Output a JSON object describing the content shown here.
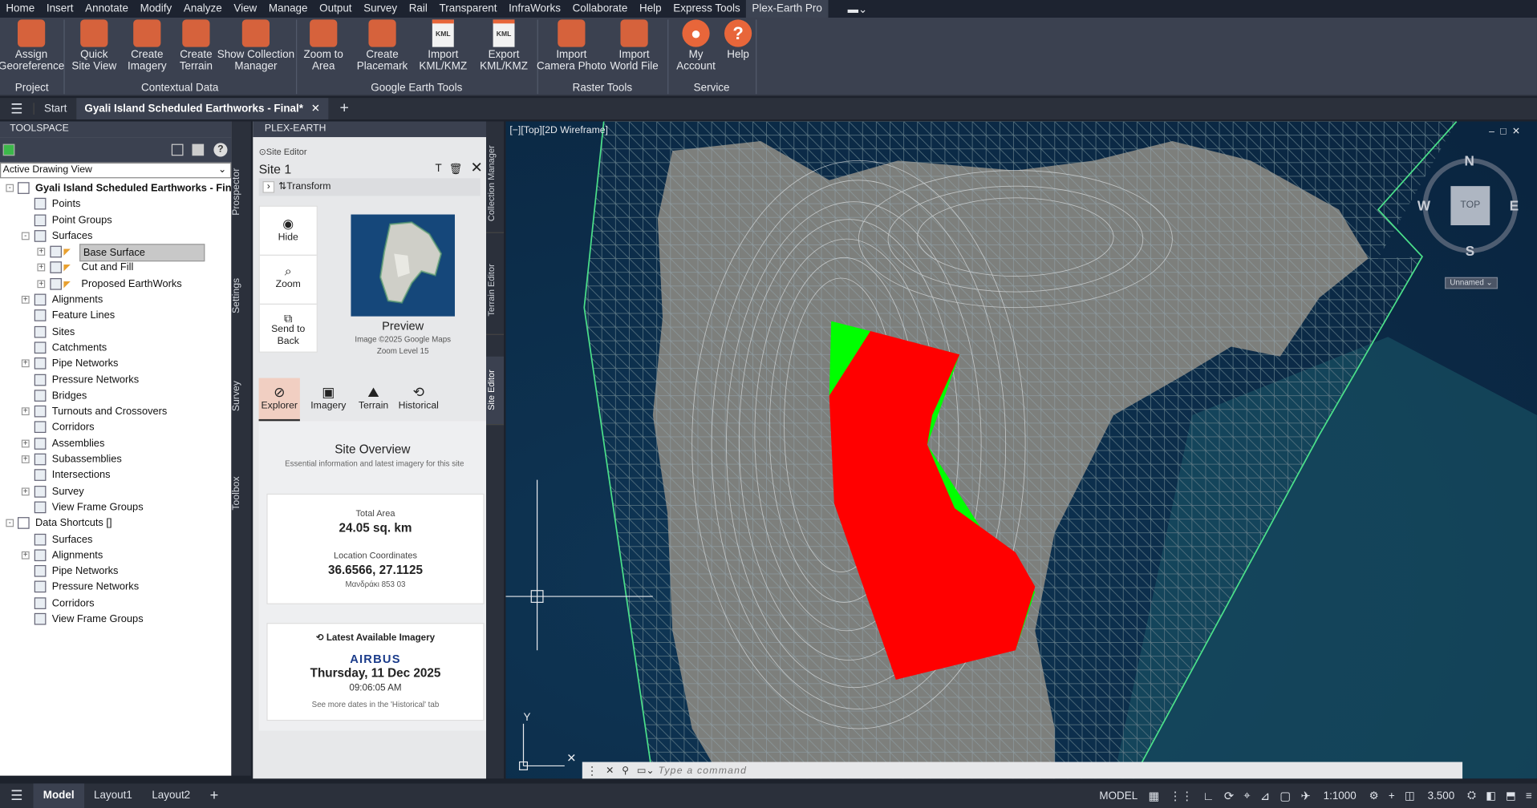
{
  "menu": [
    "Home",
    "Insert",
    "Annotate",
    "Modify",
    "Analyze",
    "View",
    "Manage",
    "Output",
    "Survey",
    "Rail",
    "Transparent",
    "InfraWorks",
    "Collaborate",
    "Help",
    "Express Tools",
    "Plex-Earth Pro"
  ],
  "ribbon": {
    "buttons": [
      {
        "l1": "Assign",
        "l2": "Georeference"
      },
      {
        "l1": "Quick",
        "l2": "Site View"
      },
      {
        "l1": "Create",
        "l2": "Imagery"
      },
      {
        "l1": "Create",
        "l2": "Terrain"
      },
      {
        "l1": "Show Collection",
        "l2": "Manager"
      },
      {
        "l1": "Zoom to",
        "l2": "Area"
      },
      {
        "l1": "Create",
        "l2": "Placemark"
      },
      {
        "l1": "Import",
        "l2": "KML/KMZ"
      },
      {
        "l1": "Export",
        "l2": "KML/KMZ"
      },
      {
        "l1": "Import",
        "l2": "Camera Photo"
      },
      {
        "l1": "Import",
        "l2": "World File"
      },
      {
        "l1": "My",
        "l2": "Account"
      },
      {
        "l1": "Help",
        "l2": ""
      }
    ],
    "panels": [
      "Project",
      "Contextual Data",
      "Google Earth Tools",
      "Raster Tools",
      "Service"
    ],
    "kml_badge": "KML"
  },
  "tabs": {
    "start": "Start",
    "document": "Gyali Island Scheduled Earthworks - Final*"
  },
  "toolspace": {
    "title": "TOOLSPACE",
    "selector": "Active Drawing View",
    "tree": [
      {
        "label": "Gyali Island Scheduled Earthworks - Final",
        "level": 0,
        "exp": "-",
        "bold": true
      },
      {
        "label": "Points",
        "level": 1
      },
      {
        "label": "Point Groups",
        "level": 1
      },
      {
        "label": "Surfaces",
        "level": 1,
        "exp": "-"
      },
      {
        "label": "Base Surface",
        "level": 2,
        "exp": "+",
        "selected": true
      },
      {
        "label": "Cut and Fill",
        "level": 2,
        "exp": "+"
      },
      {
        "label": "Proposed EarthWorks",
        "level": 2,
        "exp": "+"
      },
      {
        "label": "Alignments",
        "level": 1,
        "exp": "+"
      },
      {
        "label": "Feature Lines",
        "level": 1
      },
      {
        "label": "Sites",
        "level": 1
      },
      {
        "label": "Catchments",
        "level": 1
      },
      {
        "label": "Pipe Networks",
        "level": 1,
        "exp": "+"
      },
      {
        "label": "Pressure Networks",
        "level": 1
      },
      {
        "label": "Bridges",
        "level": 1
      },
      {
        "label": "Turnouts and Crossovers",
        "level": 1,
        "exp": "+"
      },
      {
        "label": "Corridors",
        "level": 1
      },
      {
        "label": "Assemblies",
        "level": 1,
        "exp": "+"
      },
      {
        "label": "Subassemblies",
        "level": 1,
        "exp": "+"
      },
      {
        "label": "Intersections",
        "level": 1
      },
      {
        "label": "Survey",
        "level": 1,
        "exp": "+"
      },
      {
        "label": "View Frame Groups",
        "level": 1
      },
      {
        "label": "Data Shortcuts []",
        "level": 0,
        "exp": "-"
      },
      {
        "label": "Surfaces",
        "level": 1
      },
      {
        "label": "Alignments",
        "level": 1,
        "exp": "+"
      },
      {
        "label": "Pipe Networks",
        "level": 1
      },
      {
        "label": "Pressure Networks",
        "level": 1
      },
      {
        "label": "Corridors",
        "level": 1
      },
      {
        "label": "View Frame Groups",
        "level": 1
      }
    ],
    "sidetabs": [
      "Prospector",
      "Settings",
      "Survey",
      "Toolbox"
    ]
  },
  "plex": {
    "title": "PLEX-EARTH",
    "editor_label": "Site Editor",
    "site_name": "Site 1",
    "transform": "Transform",
    "actions": [
      "Hide",
      "Zoom",
      "Send to Back"
    ],
    "preview": {
      "title": "Preview",
      "credit": "Image ©2025 Google Maps",
      "zoom": "Zoom Level 15"
    },
    "tabs": [
      "Explorer",
      "Imagery",
      "Terrain",
      "Historical"
    ],
    "overview": {
      "title": "Site Overview",
      "subtitle": "Essential information and latest imagery for this site"
    },
    "area": {
      "label": "Total Area",
      "value": "24.05 sq. km"
    },
    "coords": {
      "label": "Location Coordinates",
      "value": "36.6566, 27.1125",
      "place": "Μανδράκι 853 03"
    },
    "imagery": {
      "label": "Latest Available Imagery",
      "provider": "AIRBUS",
      "date": "Thursday, 11 Dec 2025",
      "time": "09:06:05 AM",
      "note": "See more dates in the 'Historical' tab"
    },
    "sidetabs": [
      "Collection Manager",
      "Terrain Editor",
      "Site Editor"
    ]
  },
  "viewport": {
    "label": "[−][Top][2D Wireframe]",
    "compass": {
      "N": "N",
      "S": "S",
      "E": "E",
      "W": "W",
      "top": "TOP",
      "ucs": "Unnamed"
    },
    "command_placeholder": "Type a command",
    "cut_color": "#ff0000",
    "fill_color": "#00ff00"
  },
  "status": {
    "tabs": [
      "Model",
      "Layout1",
      "Layout2"
    ],
    "model": "MODEL",
    "scale": "1:1000",
    "value": "3.500"
  }
}
